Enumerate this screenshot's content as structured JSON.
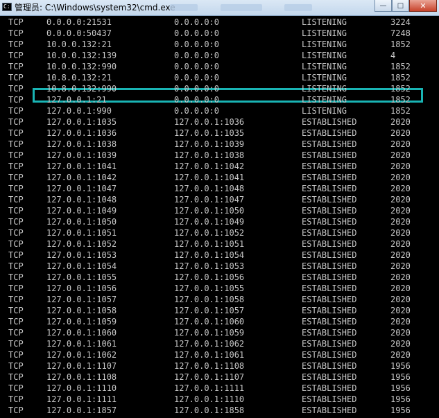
{
  "window": {
    "title": "管理员: C:\\Windows\\system32\\cmd.exe"
  },
  "controls": {
    "minimize": "—",
    "maximize": "□",
    "close": "✕"
  },
  "rows": [
    {
      "proto": "TCP",
      "local": "0.0.0.0:21531",
      "foreign": "0.0.0.0:0",
      "state": "LISTENING",
      "pid": "3224"
    },
    {
      "proto": "TCP",
      "local": "0.0.0.0:50437",
      "foreign": "0.0.0.0:0",
      "state": "LISTENING",
      "pid": "7248"
    },
    {
      "proto": "TCP",
      "local": "10.0.0.132:21",
      "foreign": "0.0.0.0:0",
      "state": "LISTENING",
      "pid": "1852"
    },
    {
      "proto": "TCP",
      "local": "10.0.0.132:139",
      "foreign": "0.0.0.0:0",
      "state": "LISTENING",
      "pid": "4"
    },
    {
      "proto": "TCP",
      "local": "10.0.0.132:990",
      "foreign": "0.0.0.0:0",
      "state": "LISTENING",
      "pid": "1852"
    },
    {
      "proto": "TCP",
      "local": "10.8.0.132:21",
      "foreign": "0.0.0.0:0",
      "state": "LISTENING",
      "pid": "1852"
    },
    {
      "proto": "TCP",
      "local": "10.8.0.132:990",
      "foreign": "0.0.0.0:0",
      "state": "LISTENING",
      "pid": "1852"
    },
    {
      "proto": "TCP",
      "local": "127.0.0.1:21",
      "foreign": "0.0.0.0:0",
      "state": "LISTENING",
      "pid": "1852"
    },
    {
      "proto": "TCP",
      "local": "127.0.0.1:990",
      "foreign": "0.0.0.0:0",
      "state": "LISTENING",
      "pid": "1852"
    },
    {
      "proto": "TCP",
      "local": "127.0.0.1:1035",
      "foreign": "127.0.0.1:1036",
      "state": "ESTABLISHED",
      "pid": "2020"
    },
    {
      "proto": "TCP",
      "local": "127.0.0.1:1036",
      "foreign": "127.0.0.1:1035",
      "state": "ESTABLISHED",
      "pid": "2020"
    },
    {
      "proto": "TCP",
      "local": "127.0.0.1:1038",
      "foreign": "127.0.0.1:1039",
      "state": "ESTABLISHED",
      "pid": "2020"
    },
    {
      "proto": "TCP",
      "local": "127.0.0.1:1039",
      "foreign": "127.0.0.1:1038",
      "state": "ESTABLISHED",
      "pid": "2020"
    },
    {
      "proto": "TCP",
      "local": "127.0.0.1:1041",
      "foreign": "127.0.0.1:1042",
      "state": "ESTABLISHED",
      "pid": "2020"
    },
    {
      "proto": "TCP",
      "local": "127.0.0.1:1042",
      "foreign": "127.0.0.1:1041",
      "state": "ESTABLISHED",
      "pid": "2020"
    },
    {
      "proto": "TCP",
      "local": "127.0.0.1:1047",
      "foreign": "127.0.0.1:1048",
      "state": "ESTABLISHED",
      "pid": "2020"
    },
    {
      "proto": "TCP",
      "local": "127.0.0.1:1048",
      "foreign": "127.0.0.1:1047",
      "state": "ESTABLISHED",
      "pid": "2020"
    },
    {
      "proto": "TCP",
      "local": "127.0.0.1:1049",
      "foreign": "127.0.0.1:1050",
      "state": "ESTABLISHED",
      "pid": "2020"
    },
    {
      "proto": "TCP",
      "local": "127.0.0.1:1050",
      "foreign": "127.0.0.1:1049",
      "state": "ESTABLISHED",
      "pid": "2020"
    },
    {
      "proto": "TCP",
      "local": "127.0.0.1:1051",
      "foreign": "127.0.0.1:1052",
      "state": "ESTABLISHED",
      "pid": "2020"
    },
    {
      "proto": "TCP",
      "local": "127.0.0.1:1052",
      "foreign": "127.0.0.1:1051",
      "state": "ESTABLISHED",
      "pid": "2020"
    },
    {
      "proto": "TCP",
      "local": "127.0.0.1:1053",
      "foreign": "127.0.0.1:1054",
      "state": "ESTABLISHED",
      "pid": "2020"
    },
    {
      "proto": "TCP",
      "local": "127.0.0.1:1054",
      "foreign": "127.0.0.1:1053",
      "state": "ESTABLISHED",
      "pid": "2020"
    },
    {
      "proto": "TCP",
      "local": "127.0.0.1:1055",
      "foreign": "127.0.0.1:1056",
      "state": "ESTABLISHED",
      "pid": "2020"
    },
    {
      "proto": "TCP",
      "local": "127.0.0.1:1056",
      "foreign": "127.0.0.1:1055",
      "state": "ESTABLISHED",
      "pid": "2020"
    },
    {
      "proto": "TCP",
      "local": "127.0.0.1:1057",
      "foreign": "127.0.0.1:1058",
      "state": "ESTABLISHED",
      "pid": "2020"
    },
    {
      "proto": "TCP",
      "local": "127.0.0.1:1058",
      "foreign": "127.0.0.1:1057",
      "state": "ESTABLISHED",
      "pid": "2020"
    },
    {
      "proto": "TCP",
      "local": "127.0.0.1:1059",
      "foreign": "127.0.0.1:1060",
      "state": "ESTABLISHED",
      "pid": "2020"
    },
    {
      "proto": "TCP",
      "local": "127.0.0.1:1060",
      "foreign": "127.0.0.1:1059",
      "state": "ESTABLISHED",
      "pid": "2020"
    },
    {
      "proto": "TCP",
      "local": "127.0.0.1:1061",
      "foreign": "127.0.0.1:1062",
      "state": "ESTABLISHED",
      "pid": "2020"
    },
    {
      "proto": "TCP",
      "local": "127.0.0.1:1062",
      "foreign": "127.0.0.1:1061",
      "state": "ESTABLISHED",
      "pid": "2020"
    },
    {
      "proto": "TCP",
      "local": "127.0.0.1:1107",
      "foreign": "127.0.0.1:1108",
      "state": "ESTABLISHED",
      "pid": "1956"
    },
    {
      "proto": "TCP",
      "local": "127.0.0.1:1108",
      "foreign": "127.0.0.1:1107",
      "state": "ESTABLISHED",
      "pid": "1956"
    },
    {
      "proto": "TCP",
      "local": "127.0.0.1:1110",
      "foreign": "127.0.0.1:1111",
      "state": "ESTABLISHED",
      "pid": "1956"
    },
    {
      "proto": "TCP",
      "local": "127.0.0.1:1111",
      "foreign": "127.0.0.1:1110",
      "state": "ESTABLISHED",
      "pid": "1956"
    },
    {
      "proto": "TCP",
      "local": "127.0.0.1:1857",
      "foreign": "127.0.0.1:1858",
      "state": "ESTABLISHED",
      "pid": "1956"
    }
  ],
  "highlight": {
    "row_index": 5,
    "color": "#19b4b4"
  },
  "colors": {
    "console_bg": "#000000",
    "console_text": "#c8c8c8",
    "titlebar": "#c3d7ec",
    "close": "#c8432a"
  }
}
